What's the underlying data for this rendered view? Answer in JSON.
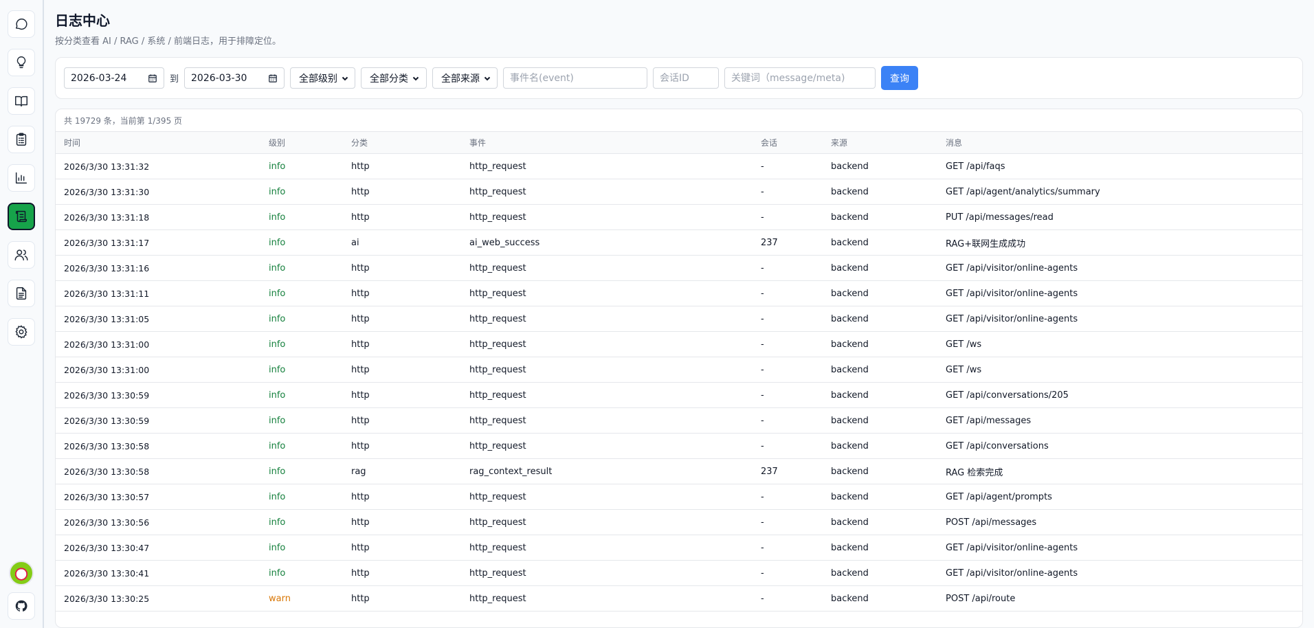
{
  "sidebar": {
    "items": [
      {
        "icon": "chat-bubble-icon"
      },
      {
        "icon": "lightbulb-icon"
      },
      {
        "icon": "book-icon"
      },
      {
        "icon": "clipboard-icon"
      },
      {
        "icon": "bar-chart-icon"
      },
      {
        "icon": "scroll-log-icon",
        "active": true
      },
      {
        "icon": "users-icon"
      },
      {
        "icon": "document-icon"
      },
      {
        "icon": "gear-icon"
      }
    ],
    "bottom": [
      {
        "icon": "avatar"
      },
      {
        "icon": "github-icon"
      }
    ]
  },
  "header": {
    "title": "日志中心",
    "subtitle": "按分类查看 AI / RAG / 系统 / 前端日志，用于排障定位。"
  },
  "filters": {
    "start_date": "2026-03-24",
    "to_label": "到",
    "end_date": "2026-03-30",
    "level_select": "全部级别",
    "category_select": "全部分类",
    "source_select": "全部来源",
    "event_placeholder": "事件名(event)",
    "session_placeholder": "会话ID",
    "keyword_placeholder": "关键词（message/meta)",
    "query_label": "查询"
  },
  "table": {
    "summary": "共 19729 条，当前第 1/395 页",
    "columns": [
      "时间",
      "级别",
      "分类",
      "事件",
      "会话",
      "来源",
      "消息"
    ],
    "rows": [
      {
        "time": "2026/3/30 13:31:32",
        "level": "info",
        "category": "http",
        "event": "http_request",
        "session": "-",
        "source": "backend",
        "message": "GET /api/faqs"
      },
      {
        "time": "2026/3/30 13:31:30",
        "level": "info",
        "category": "http",
        "event": "http_request",
        "session": "-",
        "source": "backend",
        "message": "GET /api/agent/analytics/summary"
      },
      {
        "time": "2026/3/30 13:31:18",
        "level": "info",
        "category": "http",
        "event": "http_request",
        "session": "-",
        "source": "backend",
        "message": "PUT /api/messages/read"
      },
      {
        "time": "2026/3/30 13:31:17",
        "level": "info",
        "category": "ai",
        "event": "ai_web_success",
        "session": "237",
        "source": "backend",
        "message": "RAG+联网生成成功"
      },
      {
        "time": "2026/3/30 13:31:16",
        "level": "info",
        "category": "http",
        "event": "http_request",
        "session": "-",
        "source": "backend",
        "message": "GET /api/visitor/online-agents"
      },
      {
        "time": "2026/3/30 13:31:11",
        "level": "info",
        "category": "http",
        "event": "http_request",
        "session": "-",
        "source": "backend",
        "message": "GET /api/visitor/online-agents"
      },
      {
        "time": "2026/3/30 13:31:05",
        "level": "info",
        "category": "http",
        "event": "http_request",
        "session": "-",
        "source": "backend",
        "message": "GET /api/visitor/online-agents"
      },
      {
        "time": "2026/3/30 13:31:00",
        "level": "info",
        "category": "http",
        "event": "http_request",
        "session": "-",
        "source": "backend",
        "message": "GET /ws"
      },
      {
        "time": "2026/3/30 13:31:00",
        "level": "info",
        "category": "http",
        "event": "http_request",
        "session": "-",
        "source": "backend",
        "message": "GET /ws"
      },
      {
        "time": "2026/3/30 13:30:59",
        "level": "info",
        "category": "http",
        "event": "http_request",
        "session": "-",
        "source": "backend",
        "message": "GET /api/conversations/205"
      },
      {
        "time": "2026/3/30 13:30:59",
        "level": "info",
        "category": "http",
        "event": "http_request",
        "session": "-",
        "source": "backend",
        "message": "GET /api/messages"
      },
      {
        "time": "2026/3/30 13:30:58",
        "level": "info",
        "category": "http",
        "event": "http_request",
        "session": "-",
        "source": "backend",
        "message": "GET /api/conversations"
      },
      {
        "time": "2026/3/30 13:30:58",
        "level": "info",
        "category": "rag",
        "event": "rag_context_result",
        "session": "237",
        "source": "backend",
        "message": "RAG 检索完成"
      },
      {
        "time": "2026/3/30 13:30:57",
        "level": "info",
        "category": "http",
        "event": "http_request",
        "session": "-",
        "source": "backend",
        "message": "GET /api/agent/prompts"
      },
      {
        "time": "2026/3/30 13:30:56",
        "level": "info",
        "category": "http",
        "event": "http_request",
        "session": "-",
        "source": "backend",
        "message": "POST /api/messages"
      },
      {
        "time": "2026/3/30 13:30:47",
        "level": "info",
        "category": "http",
        "event": "http_request",
        "session": "-",
        "source": "backend",
        "message": "GET /api/visitor/online-agents"
      },
      {
        "time": "2026/3/30 13:30:41",
        "level": "info",
        "category": "http",
        "event": "http_request",
        "session": "-",
        "source": "backend",
        "message": "GET /api/visitor/online-agents"
      },
      {
        "time": "2026/3/30 13:30:25",
        "level": "warn",
        "category": "http",
        "event": "http_request",
        "session": "-",
        "source": "backend",
        "message": "POST /api/route"
      }
    ]
  },
  "colors": {
    "accent": "#3b82f6",
    "active_nav": "#16a34a",
    "level_info": "#15803d",
    "level_warn": "#d97706"
  }
}
